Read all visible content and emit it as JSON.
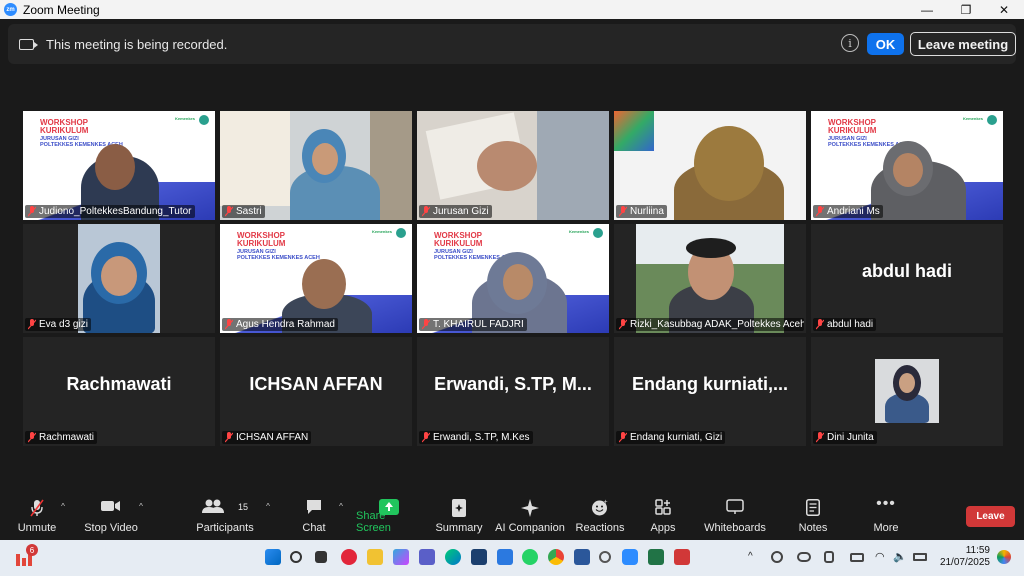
{
  "window": {
    "title": "Zoom Meeting",
    "minimize": "—",
    "maximize": "❐",
    "close": "✕"
  },
  "banner": {
    "text": "This meeting is being recorded.",
    "ok_label": "OK",
    "leave_label": "Leave meeting",
    "info_icon": "i"
  },
  "slide": {
    "title1": "WORKSHOP",
    "title2": "KURIKULUM",
    "sub1": "JURUSAN GIZI",
    "sub2": "POLTEKKES KEMENKES ACEH",
    "kemenkes": "Kemenkes"
  },
  "tiles": [
    {
      "label": "Judiono_PoltekkesBandung_Tutor"
    },
    {
      "label": "Sastri"
    },
    {
      "label": "Jurusan Gizi"
    },
    {
      "label": "Nurliina"
    },
    {
      "label": "Andriani Ms"
    },
    {
      "label": "Eva d3 gizi"
    },
    {
      "label": "Agus Hendra Rahmad"
    },
    {
      "label": "T. KHAIRUL FADJRI"
    },
    {
      "label": "Rizki_Kasubbag ADAK_Poltekkes Aceh"
    },
    {
      "label": "abdul hadi",
      "big": "abdul hadi"
    },
    {
      "label": "Rachmawati",
      "big": "Rachmawati"
    },
    {
      "label": "ICHSAN AFFAN",
      "big": "ICHSAN AFFAN"
    },
    {
      "label": "Erwandi, S.TP, M.Kes",
      "big": "Erwandi,  S.TP,  M..."
    },
    {
      "label": "Endang kurniati, Gizi",
      "big": "Endang  kurniati,..."
    },
    {
      "label": "Dini Junita"
    }
  ],
  "toolbar": {
    "unmute": "Unmute",
    "stop_video": "Stop Video",
    "participants": "Participants",
    "participants_count": "15",
    "chat": "Chat",
    "share_screen": "Share Screen",
    "summary": "Summary",
    "ai_companion": "AI Companion",
    "reactions": "Reactions",
    "apps": "Apps",
    "whiteboards": "Whiteboards",
    "notes": "Notes",
    "more": "More",
    "leave": "Leave"
  },
  "taskbar": {
    "time": "11:59",
    "date": "21/07/2025",
    "badge": "6"
  },
  "colors": {
    "accent": "#0e72ed",
    "leave": "#d13838",
    "share": "#21c55d",
    "speaker_outline": "#e8ec6a"
  }
}
